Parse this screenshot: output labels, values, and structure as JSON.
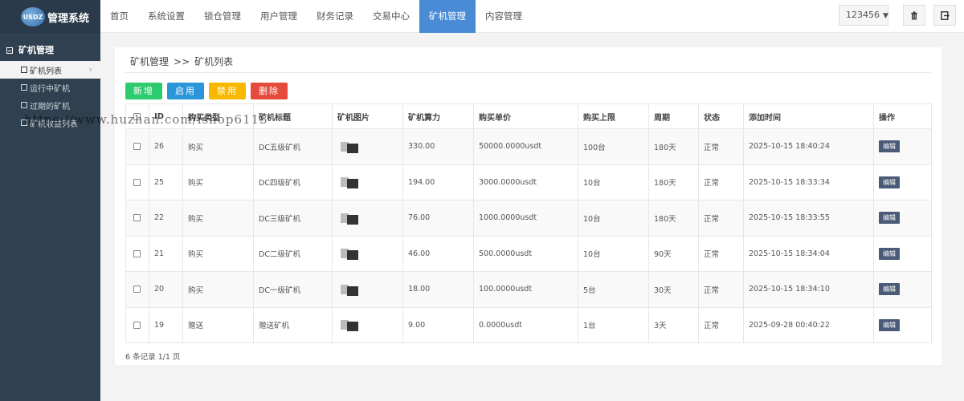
{
  "app": {
    "logo_text": "管理系统",
    "logo_mark": "USDZ"
  },
  "sidebar": {
    "group_title": "矿机管理",
    "items": [
      {
        "label": "矿机列表",
        "active": true
      },
      {
        "label": "运行中矿机",
        "active": false
      },
      {
        "label": "过期的矿机",
        "active": false
      },
      {
        "label": "矿机收益列表",
        "active": false
      }
    ]
  },
  "topnav": {
    "items": [
      {
        "label": "首页"
      },
      {
        "label": "系统设置"
      },
      {
        "label": "锁仓管理"
      },
      {
        "label": "用户管理"
      },
      {
        "label": "财务记录"
      },
      {
        "label": "交易中心"
      },
      {
        "label": "矿机管理"
      },
      {
        "label": "内容管理"
      }
    ],
    "active_index": 6,
    "user": "123456",
    "trash_icon": "trash-icon",
    "logout_icon": "logout-icon"
  },
  "breadcrumb": {
    "section": "矿机管理",
    "separator": ">>",
    "page": "矿机列表"
  },
  "toolbar": {
    "add_label": "新增",
    "enable_label": "启用",
    "disable_label": "禁用",
    "delete_label": "删除"
  },
  "table": {
    "headers": [
      "",
      "ID",
      "购买类型",
      "矿机标题",
      "矿机图片",
      "矿机算力",
      "购买单价",
      "购买上限",
      "周期",
      "状态",
      "添加时间",
      "操作"
    ],
    "rows": [
      {
        "id": "26",
        "type": "购买",
        "type_kind": "buy",
        "title": "DC五级矿机",
        "power": "330.00",
        "price": "50000.0000usdt",
        "limit": "100台",
        "cycle": "180天",
        "status": "正常",
        "time": "2025-10-15 18:40:24",
        "action": "编辑"
      },
      {
        "id": "25",
        "type": "购买",
        "type_kind": "buy",
        "title": "DC四级矿机",
        "power": "194.00",
        "price": "3000.0000usdt",
        "limit": "10台",
        "cycle": "180天",
        "status": "正常",
        "time": "2025-10-15 18:33:34",
        "action": "编辑"
      },
      {
        "id": "22",
        "type": "购买",
        "type_kind": "buy",
        "title": "DC三级矿机",
        "power": "76.00",
        "price": "1000.0000usdt",
        "limit": "10台",
        "cycle": "180天",
        "status": "正常",
        "time": "2025-10-15 18:33:55",
        "action": "编辑"
      },
      {
        "id": "21",
        "type": "购买",
        "type_kind": "buy",
        "title": "DC二级矿机",
        "power": "46.00",
        "price": "500.0000usdt",
        "limit": "10台",
        "cycle": "90天",
        "status": "正常",
        "time": "2025-10-15 18:34:04",
        "action": "编辑"
      },
      {
        "id": "20",
        "type": "购买",
        "type_kind": "buy",
        "title": "DC一级矿机",
        "power": "18.00",
        "price": "100.0000usdt",
        "limit": "5台",
        "cycle": "30天",
        "status": "正常",
        "time": "2025-10-15 18:34:10",
        "action": "编辑"
      },
      {
        "id": "19",
        "type": "赠送",
        "type_kind": "gift",
        "title": "赠送矿机",
        "power": "9.00",
        "price": "0.0000usdt",
        "limit": "1台",
        "cycle": "3天",
        "status": "正常",
        "time": "2025-09-28 00:40:22",
        "action": "编辑"
      }
    ]
  },
  "pagination": {
    "summary": "6 条记录 1/1 页"
  },
  "watermark": "https://www.huzhan.com/ishop6113",
  "colors": {
    "sidebar_bg": "#2f4050",
    "nav_active": "#4a8bd6",
    "buy": "#1a8a3a",
    "gift": "#e02020",
    "edit_btn": "#4b5a76"
  }
}
